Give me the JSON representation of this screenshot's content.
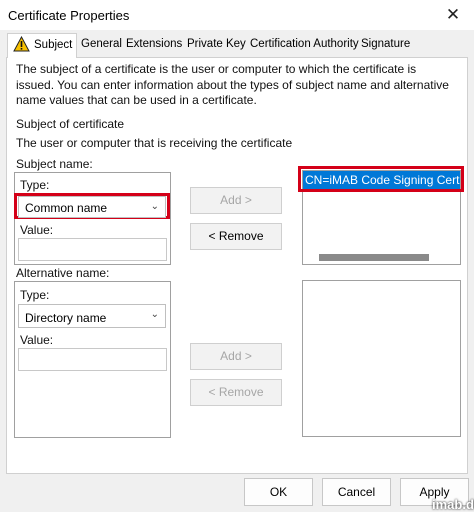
{
  "window": {
    "title": "Certificate Properties",
    "close_glyph": "✕"
  },
  "tabs": [
    {
      "label": "Subject",
      "active": true,
      "icon": "warning-icon"
    },
    {
      "label": "General"
    },
    {
      "label": "Extensions"
    },
    {
      "label": "Private Key"
    },
    {
      "label": "Certification Authority"
    },
    {
      "label": "Signature"
    }
  ],
  "intro_text": "The subject of a certificate is the user or computer to which the certificate is issued. You can enter information about the types of subject name and alternative name values that can be used in a certificate.",
  "subject_section": {
    "heading": "Subject of certificate",
    "description": "The user or computer that is receiving the certificate"
  },
  "subject_name": {
    "group_label": "Subject name:",
    "type_label": "Type:",
    "type_selected": "Common name",
    "value_label": "Value:",
    "value": "",
    "add_button": "Add >",
    "remove_button": "< Remove",
    "list_items": [
      "CN=iMAB Code Signing Certif"
    ]
  },
  "alternative_name": {
    "group_label": "Alternative name:",
    "type_label": "Type:",
    "type_selected": "Directory name",
    "value_label": "Value:",
    "value": "",
    "add_button": "Add >",
    "remove_button": "< Remove"
  },
  "footer": {
    "ok": "OK",
    "cancel": "Cancel",
    "apply": "Apply"
  },
  "watermark": "imab.dk",
  "colors": {
    "highlight": "#d40018",
    "selection": "#0078d7"
  }
}
